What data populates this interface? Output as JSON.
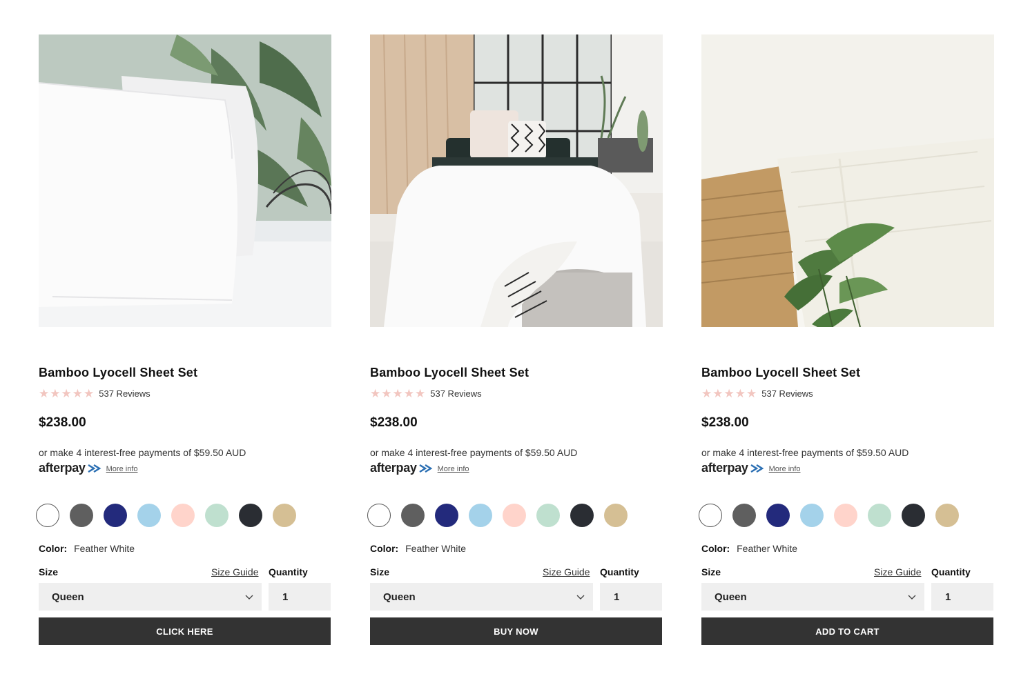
{
  "theme": {
    "button_bg": "#333333",
    "star_color": "#f2c6c0",
    "input_bg": "#efefef"
  },
  "swatch_colors": [
    "#ffffff",
    "#5f5f5f",
    "#232a7c",
    "#a4d2ea",
    "#ffd4cb",
    "#bfe0cf",
    "#2a2d33",
    "#d5bf94"
  ],
  "products": [
    {
      "image": "pillows-photo",
      "title": "Bamboo Lyocell Sheet Set",
      "rating_stars": 5,
      "reviews": "537 Reviews",
      "price": "$238.00",
      "afterpay_text": "or make 4 interest-free payments of $59.50 AUD",
      "afterpay_brand": "afterpay",
      "more_info": "More info",
      "color_label": "Color:",
      "color_value": "Feather White",
      "size_label": "Size",
      "size_guide": "Size Guide",
      "quantity_label": "Quantity",
      "size_value": "Queen",
      "quantity_value": "1",
      "cta": "CLICK HERE"
    },
    {
      "image": "bedroom-photo",
      "title": "Bamboo Lyocell Sheet Set",
      "rating_stars": 5,
      "reviews": "537 Reviews",
      "price": "$238.00",
      "afterpay_text": "or make 4 interest-free payments of $59.50 AUD",
      "afterpay_brand": "afterpay",
      "more_info": "More info",
      "color_label": "Color:",
      "color_value": "Feather White",
      "size_label": "Size",
      "size_guide": "Size Guide",
      "quantity_label": "Quantity",
      "size_value": "Queen",
      "quantity_value": "1",
      "cta": "BUY NOW"
    },
    {
      "image": "sheet-corner-photo",
      "title": "Bamboo Lyocell Sheet Set",
      "rating_stars": 5,
      "reviews": "537 Reviews",
      "price": "$238.00",
      "afterpay_text": "or make 4 interest-free payments of $59.50 AUD",
      "afterpay_brand": "afterpay",
      "more_info": "More info",
      "color_label": "Color:",
      "color_value": "Feather White",
      "size_label": "Size",
      "size_guide": "Size Guide",
      "quantity_label": "Quantity",
      "size_value": "Queen",
      "quantity_value": "1",
      "cta": "ADD TO CART"
    }
  ]
}
